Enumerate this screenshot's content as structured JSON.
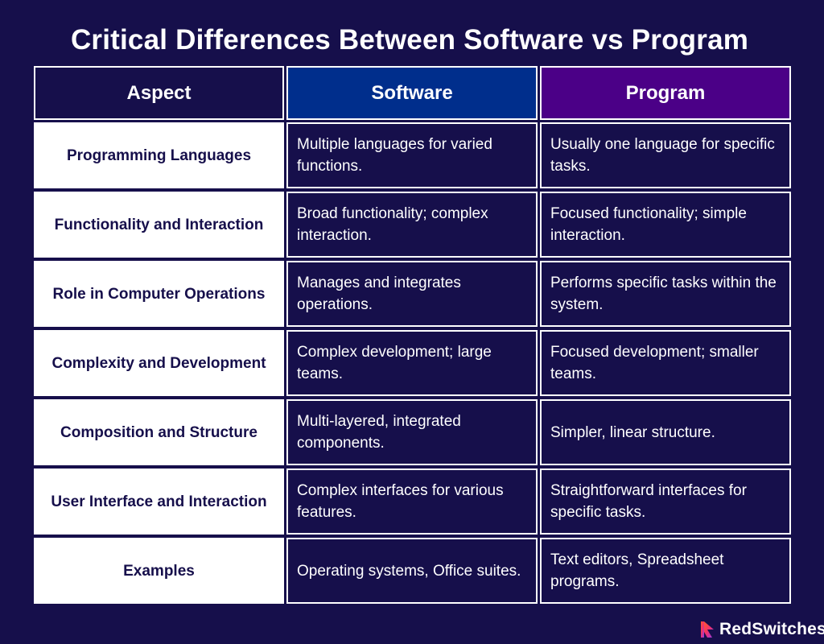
{
  "title": "Critical Differences Between Software vs Program",
  "table": {
    "headers": [
      "Aspect",
      "Software",
      "Program"
    ],
    "header_colors": {
      "aspect": "#160f4b",
      "software": "#002e8c",
      "program": "#4b0087"
    },
    "rows": [
      {
        "aspect": "Programming Languages",
        "software": "Multiple languages for varied functions.",
        "program": "Usually one language for specific tasks."
      },
      {
        "aspect": "Functionality and Interaction",
        "software": "Broad functionality; complex interaction.",
        "program": "Focused functionality; simple interaction."
      },
      {
        "aspect": "Role in Computer Operations",
        "software": "Manages and integrates operations.",
        "program": "Performs specific tasks within the system."
      },
      {
        "aspect": "Complexity and Development",
        "software": "Complex development; large teams.",
        "program": "Focused development; smaller teams."
      },
      {
        "aspect": "Composition and Structure",
        "software": "Multi-layered, integrated components.",
        "program": "Simpler, linear structure."
      },
      {
        "aspect": "User Interface and Interaction",
        "software": "Complex interfaces for various features.",
        "program": "Straightforward interfaces for specific tasks."
      },
      {
        "aspect": "Examples",
        "software": "Operating systems, Office suites.",
        "program": "Text editors, Spreadsheet programs."
      }
    ]
  },
  "brand": {
    "name": "RedSwitches",
    "icon": "redswitches-logo-icon"
  },
  "colors": {
    "background": "#160f4b",
    "text_light": "#ffffff",
    "aspect_bg": "#ffffff"
  }
}
